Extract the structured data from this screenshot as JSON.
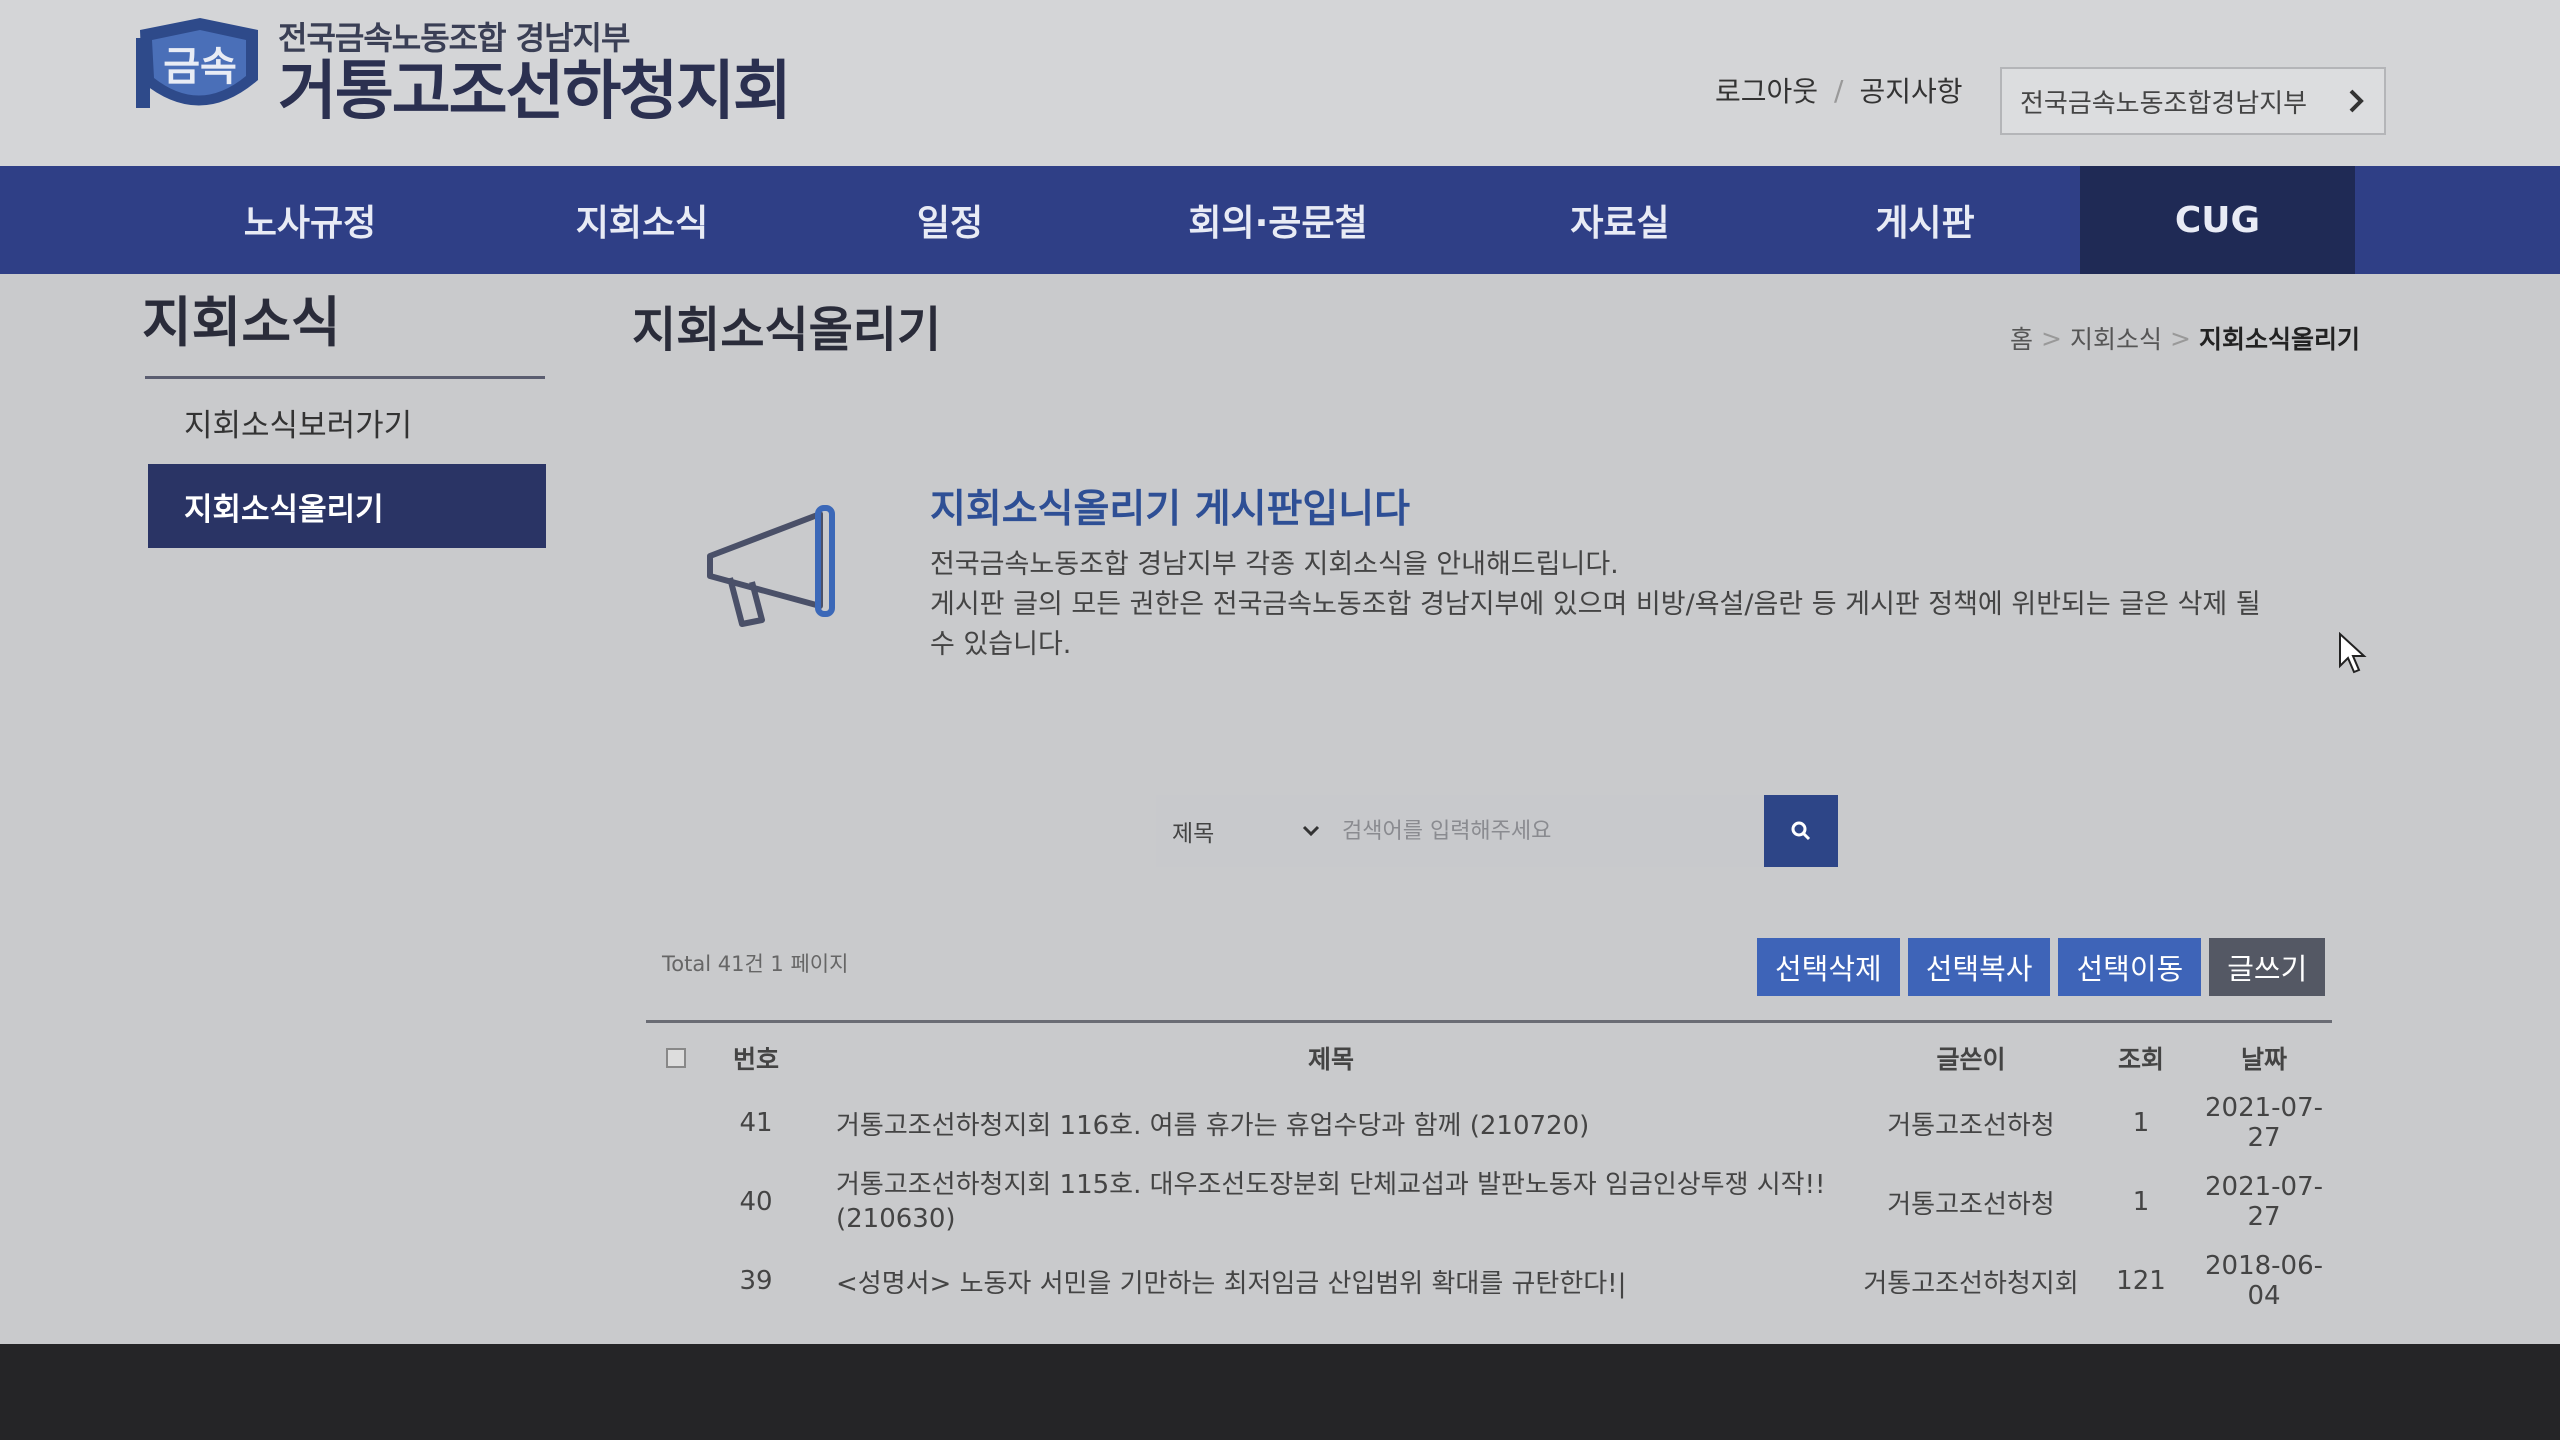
{
  "header": {
    "org_sub": "전국금속노동조합 경남지부",
    "org_main": "거통고조선하청지회",
    "logout": "로그아웃",
    "notice": "공지사항",
    "branch_link": "전국금속노동조합경남지부"
  },
  "nav": [
    "노사규정",
    "지회소식",
    "일정",
    "회의·공문철",
    "자료실",
    "게시판",
    "CUG"
  ],
  "sidebar": {
    "title": "지회소식",
    "items": [
      "지회소식보러가기",
      "지회소식올리기"
    ]
  },
  "main": {
    "title": "지회소식올리기",
    "breadcrumb": [
      "홈",
      "지회소식",
      "지회소식올리기"
    ],
    "intro_title": "지회소식올리기 게시판입니다",
    "intro_line1": "전국금속노동조합 경남지부 각종 지회소식을 안내해드립니다.",
    "intro_line2": "게시판 글의 모든 권한은 전국금속노동조합 경남지부에 있으며 비방/욕설/음란 등 게시판 정책에 위반되는 글은 삭제 될 수 있습니다."
  },
  "search": {
    "select_value": "제목",
    "placeholder": "검색어를 입력해주세요"
  },
  "list": {
    "total": "Total 41건 1 페이지",
    "buttons": [
      "선택삭제",
      "선택복사",
      "선택이동",
      "글쓰기"
    ],
    "headers": [
      "번호",
      "제목",
      "글쓴이",
      "조회",
      "날짜"
    ],
    "rows": [
      {
        "num": "41",
        "title": "거통고조선하청지회 116호. 여름 휴가는 휴업수당과 함께 (210720)",
        "author": "거통고조선하청",
        "views": "1",
        "date": "2021-07-27"
      },
      {
        "num": "40",
        "title": "거통고조선하청지회 115호. 대우조선도장분회 단체교섭과 발판노동자 임금인상투쟁 시작!! (210630)",
        "author": "거통고조선하청",
        "views": "1",
        "date": "2021-07-27"
      },
      {
        "num": "39",
        "title": "<성명서> 노동자 서민을 기만하는 최저임금 산입범위 확대를 규탄한다!|",
        "author": "거통고조선하청지회",
        "views": "121",
        "date": "2018-06-04"
      }
    ]
  },
  "colors": {
    "nav_bg": "#2f3f86",
    "nav_active_bg": "#1f2a55",
    "sidebar_active_bg": "#2a3465",
    "accent_blue": "#3e64b8",
    "intro_title": "#2e4f95"
  },
  "icons": [
    "megaphone-icon",
    "search-icon",
    "chevron-right-icon",
    "chevron-down-icon"
  ]
}
